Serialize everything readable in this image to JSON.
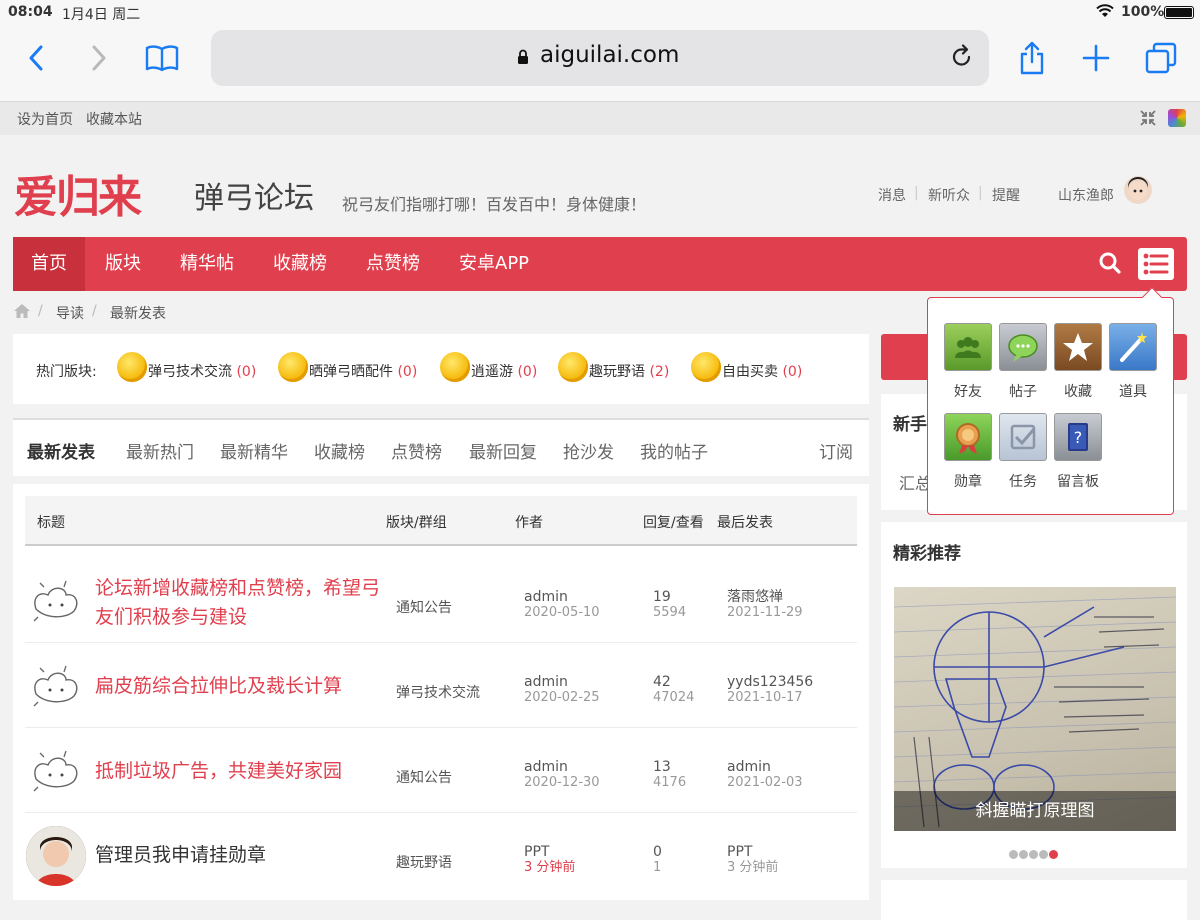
{
  "status_bar": {
    "time": "08:04",
    "date": "1月4日 周二",
    "battery": "100%"
  },
  "browser": {
    "url": "aiguilai.com"
  },
  "quick_links": [
    "设为首页",
    "收藏本站"
  ],
  "header": {
    "logo_main": "爱归来",
    "logo_sub": "弹弓论坛",
    "slogan": "祝弓友们指哪打哪！百发百中！身体健康！",
    "links": [
      "消息",
      "新听众",
      "提醒"
    ],
    "username": "山东渔郎"
  },
  "nav": {
    "items": [
      "首页",
      "版块",
      "精华帖",
      "收藏榜",
      "点赞榜",
      "安卓APP"
    ]
  },
  "breadcrumb": [
    "导读",
    "最新发表"
  ],
  "hot_forums": {
    "label": "热门版块:",
    "items": [
      {
        "name": "弹弓技术交流",
        "count": "(0)"
      },
      {
        "name": "晒弹弓晒配件",
        "count": "(0)"
      },
      {
        "name": "逍遥游",
        "count": "(0)"
      },
      {
        "name": "趣玩野语",
        "count": "(2)"
      },
      {
        "name": "自由买卖",
        "count": "(0)"
      }
    ]
  },
  "tabs": [
    "最新发表",
    "最新热门",
    "最新精华",
    "收藏榜",
    "点赞榜",
    "最新回复",
    "抢沙发",
    "我的帖子"
  ],
  "subscribe": "订阅",
  "table": {
    "headers": [
      "标题",
      "版块/群组",
      "作者",
      "回复/查看",
      "最后发表"
    ],
    "rows": [
      {
        "title": "论坛新增收藏榜和点赞榜，希望弓友们积极参与建设",
        "forum": "通知公告",
        "author": "admin",
        "date": "2020-05-10",
        "replies": "19",
        "views": "5594",
        "last_user": "落雨悠禅",
        "last_date": "2021-11-29"
      },
      {
        "title": "扁皮筋综合拉伸比及裁长计算",
        "forum": "弹弓技术交流",
        "author": "admin",
        "date": "2020-02-25",
        "replies": "42",
        "views": "47024",
        "last_user": "yyds123456",
        "last_date": "2021-10-17"
      },
      {
        "title": "抵制垃圾广告，共建美好家园",
        "forum": "通知公告",
        "author": "admin",
        "date": "2020-12-30",
        "replies": "13",
        "views": "4176",
        "last_user": "admin",
        "last_date": "2021-02-03"
      },
      {
        "title": "管理员我申请挂勋章",
        "forum": "趣玩野语",
        "author": "PPT",
        "date": "3 分钟前",
        "replies": "0",
        "views": "1",
        "last_user": "PPT",
        "last_date": "3 分钟前"
      }
    ]
  },
  "sidebar": {
    "box1_title": "新手",
    "box1_text": "汇总",
    "featured_title": "精彩推荐",
    "featured_caption": "斜握瞄打原理图"
  },
  "popup_menu": {
    "items": [
      {
        "label": "好友",
        "color": "#6aaa3a"
      },
      {
        "label": "帖子",
        "color": "#8a8f96"
      },
      {
        "label": "收藏",
        "color": "#8a5a2e"
      },
      {
        "label": "道具",
        "color": "#4a8ad4"
      },
      {
        "label": "勋章",
        "color": "#5aaa3a"
      },
      {
        "label": "任务",
        "color": "#b8c4d4"
      },
      {
        "label": "留言板",
        "color": "#3a4a7a"
      }
    ]
  },
  "colors": {
    "accent": "#e0404e",
    "ios_blue": "#1a7cf4"
  }
}
